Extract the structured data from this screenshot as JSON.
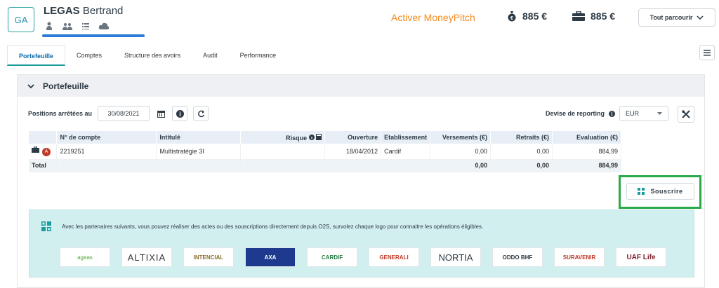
{
  "header": {
    "avatar": "GA",
    "last_name": "LEGAS",
    "first_name": "Bertrand",
    "progress": 1.0,
    "moneypitch": "Activer MoneyPitch",
    "amount1": "885 €",
    "amount2": "885 €",
    "parcourir": "Tout parcourir"
  },
  "tabs": [
    "Portefeuille",
    "Comptes",
    "Structure des avoirs",
    "Audit",
    "Performance"
  ],
  "panel": {
    "title": "Portefeuille",
    "positions_label": "Positions arrêtées au",
    "date": "30/08/2021",
    "devise_label": "Devise de reporting",
    "devise": "EUR"
  },
  "table": {
    "headers": [
      "",
      "N° de compte",
      "Intitulé",
      "Risque",
      "Ouverture",
      "Etablissement",
      "Versements (€)",
      "Retraits (€)",
      "Evaluation (€)"
    ],
    "row": {
      "badge": "A",
      "compte": "2219251",
      "intitule": "Multistratégie 3I",
      "ouverture": "18/04/2012",
      "etablissement": "Cardif",
      "versements": "0,00",
      "retraits": "0,00",
      "evaluation": "884,99"
    },
    "total": {
      "label": "Total",
      "versements": "0,00",
      "retraits": "0,00",
      "evaluation": "884,99"
    }
  },
  "souscrire": "Souscrire",
  "partners": {
    "text": "Avec les partenaires suivants, vous pouvez réaliser des actes ou des souscriptions directement depuis O2S, survolez chaque logo pour connaitre les opérations éligibles.",
    "logos": [
      "ageas",
      "ALTIXIA",
      "INTENCIAL",
      "AXA",
      "CARDIF",
      "GENERALI",
      "NORTIA",
      "ODDO BHF",
      "SURAVENIR",
      "UAF Life"
    ]
  },
  "colors": {
    "accent": "#1a9c9c",
    "moneypitch": "#f28b1f",
    "highlight": "#2aa84a"
  }
}
